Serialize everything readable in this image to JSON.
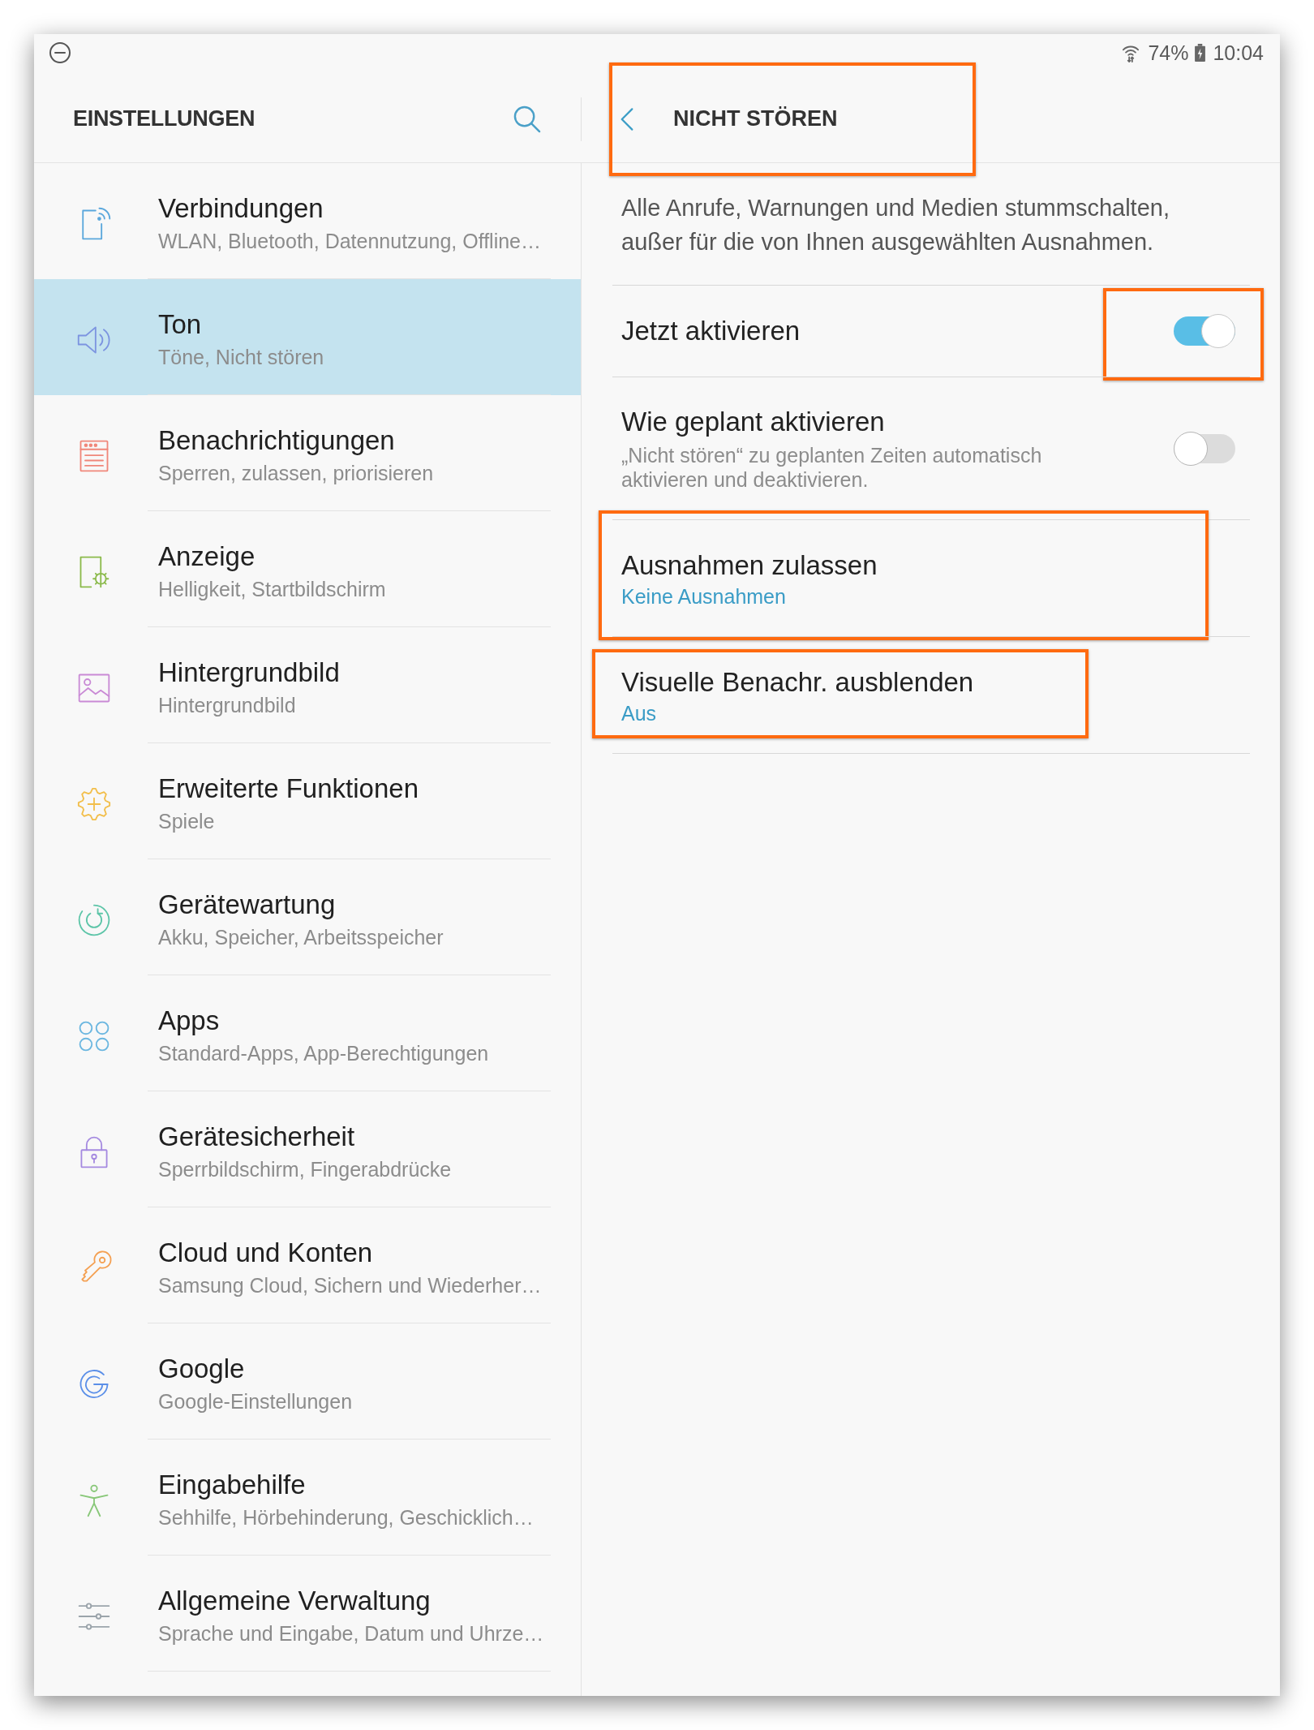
{
  "status_bar": {
    "battery": "74%",
    "time": "10:04"
  },
  "sidebar": {
    "title": "EINSTELLUNGEN",
    "items": [
      {
        "label": "Verbindungen",
        "sublabel": "WLAN, Bluetooth, Datennutzung, Offline…",
        "selected": false
      },
      {
        "label": "Ton",
        "sublabel": "Töne, Nicht stören",
        "selected": true
      },
      {
        "label": "Benachrichtigungen",
        "sublabel": "Sperren, zulassen, priorisieren",
        "selected": false
      },
      {
        "label": "Anzeige",
        "sublabel": "Helligkeit, Startbildschirm",
        "selected": false
      },
      {
        "label": "Hintergrundbild",
        "sublabel": "Hintergrundbild",
        "selected": false
      },
      {
        "label": "Erweiterte Funktionen",
        "sublabel": "Spiele",
        "selected": false
      },
      {
        "label": "Gerätewartung",
        "sublabel": "Akku, Speicher, Arbeitsspeicher",
        "selected": false
      },
      {
        "label": "Apps",
        "sublabel": "Standard-Apps, App-Berechtigungen",
        "selected": false
      },
      {
        "label": "Gerätesicherheit",
        "sublabel": "Sperrbildschirm, Fingerabdrücke",
        "selected": false
      },
      {
        "label": "Cloud und Konten",
        "sublabel": "Samsung Cloud, Sichern und Wiederher…",
        "selected": false
      },
      {
        "label": "Google",
        "sublabel": "Google-Einstellungen",
        "selected": false
      },
      {
        "label": "Eingabehilfe",
        "sublabel": "Sehhilfe, Hörbehinderung, Geschicklich…",
        "selected": false
      },
      {
        "label": "Allgemeine Verwaltung",
        "sublabel": "Sprache und Eingabe, Datum und Uhrze…",
        "selected": false
      }
    ]
  },
  "detail": {
    "title": "NICHT STÖREN",
    "highlighted": true,
    "description": "Alle Anrufe, Warnungen und Medien stummschalten, außer für die von Ihnen ausgewählten Ausnahmen.",
    "rows": [
      {
        "kind": "switch",
        "label": "Jetzt aktivieren",
        "on": true,
        "highlight": {
          "kind": "switch"
        }
      },
      {
        "kind": "switch",
        "label": "Wie geplant aktivieren",
        "description": "„Nicht stören“ zu geplanten Zeiten automatisch aktivieren und deaktivieren.",
        "on": false
      },
      {
        "kind": "link",
        "label": "Ausnahmen zulassen",
        "value": "Keine Ausnahmen",
        "highlight": {
          "kind": "row"
        }
      },
      {
        "kind": "link",
        "label": "Visuelle Benachr. ausblenden",
        "value": "Aus",
        "highlight": {
          "kind": "label"
        }
      }
    ]
  }
}
